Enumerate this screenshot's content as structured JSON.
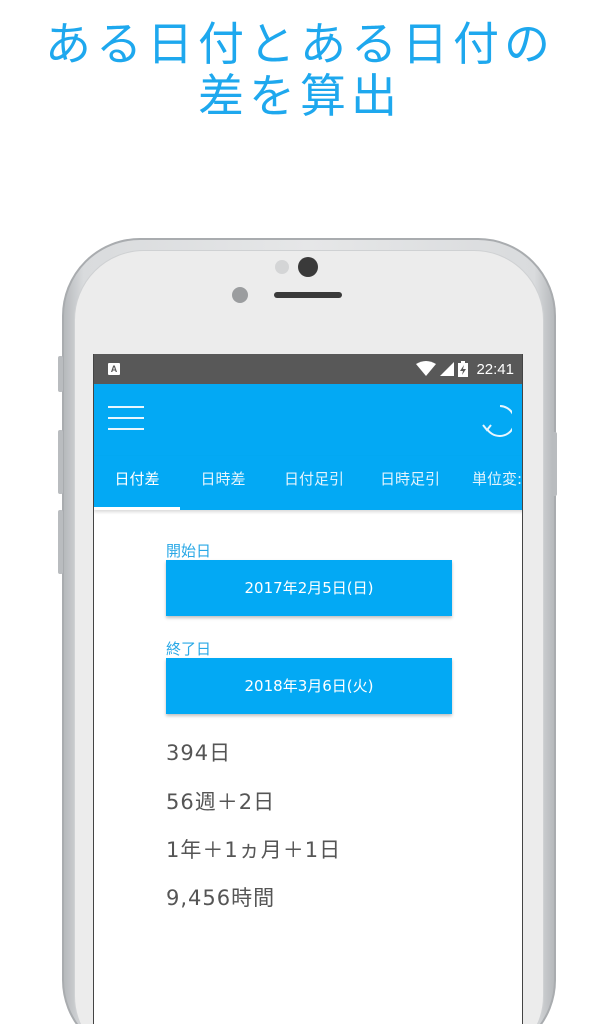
{
  "promo": {
    "headline_line1": "ある日付とある日付の",
    "headline_line2": "差を算出",
    "color": "#1ea8ee"
  },
  "statusbar": {
    "left_icon_letter": "A",
    "time": "22:41",
    "icons": [
      "wifi-icon",
      "signal-icon",
      "battery-charging-icon"
    ]
  },
  "appbar": {
    "color": "#03a9f4",
    "icons": [
      "menu-icon",
      "refresh-icon"
    ]
  },
  "tabs": {
    "items": [
      {
        "label": "日付差",
        "selected": true
      },
      {
        "label": "日時差",
        "selected": false
      },
      {
        "label": "日付足引",
        "selected": false
      },
      {
        "label": "日時足引",
        "selected": false
      },
      {
        "label": "単位変:",
        "selected": false
      }
    ]
  },
  "form": {
    "start_label": "開始日",
    "start_value": "2017年2月5日(日)",
    "end_label": "終了日",
    "end_value": "2018年3月6日(火)"
  },
  "results": {
    "days": "394日",
    "weeks": "56週＋2日",
    "ymd": "1年＋1ヵ月＋1日",
    "hours": "9,456時間"
  }
}
